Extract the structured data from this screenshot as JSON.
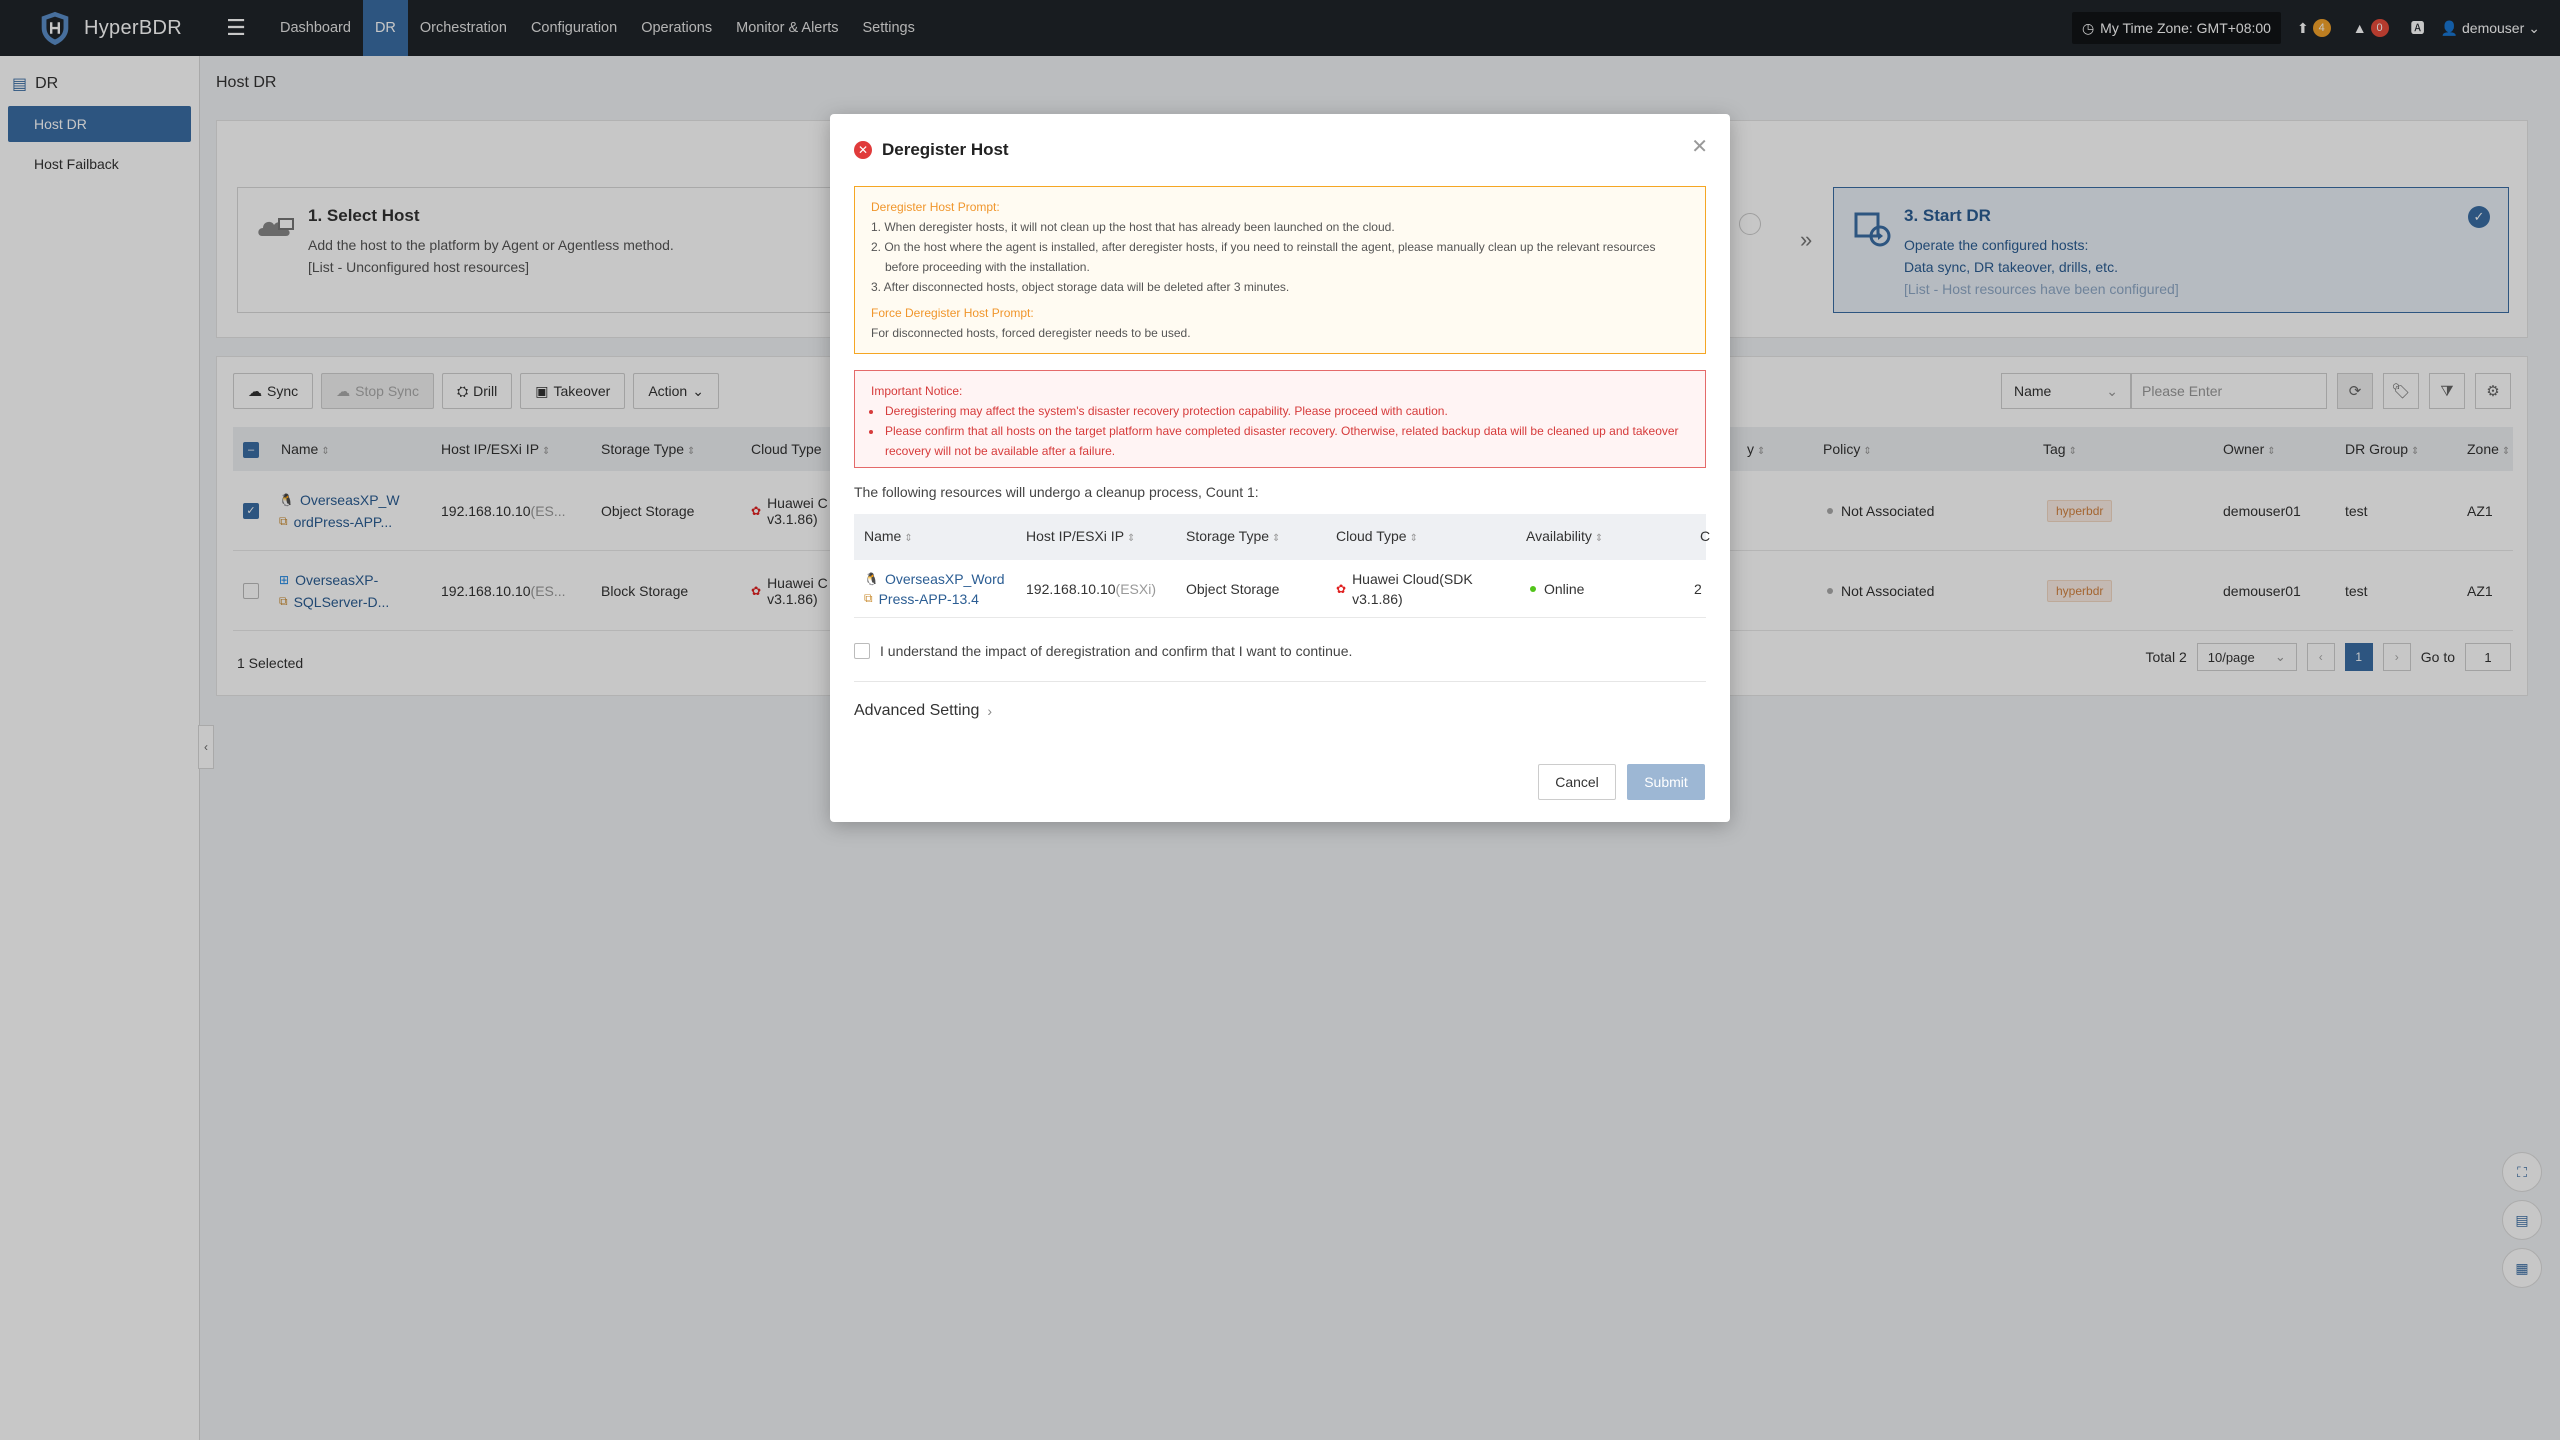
{
  "app": {
    "name": "HyperBDR"
  },
  "nav": {
    "items": [
      {
        "label": "Dashboard"
      },
      {
        "label": "DR"
      },
      {
        "label": "Orchestration"
      },
      {
        "label": "Configuration"
      },
      {
        "label": "Operations"
      },
      {
        "label": "Monitor & Alerts"
      },
      {
        "label": "Settings"
      }
    ],
    "active": "DR"
  },
  "topright": {
    "timezone": "My Time Zone: GMT+08:00",
    "upload_count": "4",
    "alert_count": "0",
    "user": "demouser"
  },
  "sidebar": {
    "group": "DR",
    "items": [
      {
        "label": "Host DR"
      },
      {
        "label": "Host Failback"
      }
    ]
  },
  "page": {
    "title": "Host DR"
  },
  "steps": [
    {
      "title": "1. Select Host",
      "desc1": "Add the host to the platform by Agent or Agentless method.",
      "desc2": "[List - Unconfigured host resources]"
    },
    {
      "title": "3. Start DR",
      "desc1": "Operate the configured hosts:",
      "desc2": "Data sync, DR takeover, drills, etc.",
      "desc3": "[List - Host resources have been configured]"
    }
  ],
  "toolbar": {
    "sync": "Sync",
    "stop_sync": "Stop Sync",
    "drill": "Drill",
    "takeover": "Takeover",
    "action": "Action"
  },
  "search": {
    "field": "Name",
    "placeholder": "Please Enter"
  },
  "table": {
    "headers": {
      "name": "Name",
      "ip": "Host IP/ESXi IP",
      "storage": "Storage Type",
      "cloud": "Cloud Type",
      "policy": "Policy",
      "tag": "Tag",
      "owner": "Owner",
      "group": "DR Group",
      "zone": "Zone",
      "partial": "y"
    },
    "rows": [
      {
        "name1": "OverseasXP_W",
        "name2": "ordPress-APP...",
        "ip": "192.168.10.10",
        "ip_suffix": "(ES...",
        "storage": "Object Storage",
        "cloud1": "Huawei C",
        "cloud2": "v3.1.86)",
        "policy": "Not Associated",
        "tag": "hyperbdr",
        "owner": "demouser01",
        "group": "test",
        "zone": "AZ1"
      },
      {
        "name1": "OverseasXP-",
        "name2": "SQLServer-D...",
        "ip": "192.168.10.10",
        "ip_suffix": "(ES...",
        "storage": "Block Storage",
        "cloud1": "Huawei C",
        "cloud2": "v3.1.86)",
        "policy": "Not Associated",
        "tag": "hyperbdr",
        "owner": "demouser01",
        "group": "test",
        "zone": "AZ1"
      }
    ],
    "selected": "1 Selected"
  },
  "pagination": {
    "total": "Total 2",
    "per_page": "10/page",
    "current": "1",
    "goto_label": "Go to",
    "goto_value": "1"
  },
  "modal": {
    "title": "Deregister Host",
    "warn_title": "Deregister Host Prompt:",
    "warn_1": "1. When deregister hosts, it will not clean up the host that has already been launched on the cloud.",
    "warn_2": "2. On the host where the agent is installed, after deregister hosts, if you need to reinstall the agent, please manually clean up the relevant resources before proceeding with the installation.",
    "warn_3": "3. After disconnected hosts, object storage data will be deleted after 3 minutes.",
    "force_title": "Force Deregister Host Prompt:",
    "force_1": "For disconnected hosts, forced deregister needs to be used.",
    "notice_title": "Important Notice:",
    "notice_1": "Deregistering may affect the system's disaster recovery protection capability. Please proceed with caution.",
    "notice_2": "Please confirm that all hosts on the target platform have completed disaster recovery. Otherwise, related backup data will be cleaned up and takeover recovery will not be available after a failure.",
    "count_text": "The following resources will undergo a cleanup process, Count 1:",
    "headers": {
      "name": "Name",
      "ip": "Host IP/ESXi IP",
      "storage": "Storage Type",
      "cloud": "Cloud Type",
      "availability": "Availability",
      "partial": "C"
    },
    "row": {
      "name1": "OverseasXP_Word",
      "name2": "Press-APP-13.4",
      "ip": "192.168.10.10",
      "ip_suffix": "(ESXi)",
      "storage": "Object Storage",
      "cloud1": "Huawei Cloud(SDK",
      "cloud2": "v3.1.86)",
      "availability": "Online",
      "partial": "2"
    },
    "confirm_text": "I understand the impact of deregistration and confirm that I want to continue.",
    "advanced": "Advanced Setting",
    "cancel": "Cancel",
    "submit": "Submit"
  },
  "colors": {
    "accent": "#3a6ea5",
    "topbar": "#1f2429",
    "warning": "#f5a623",
    "danger": "#e03b3b"
  }
}
